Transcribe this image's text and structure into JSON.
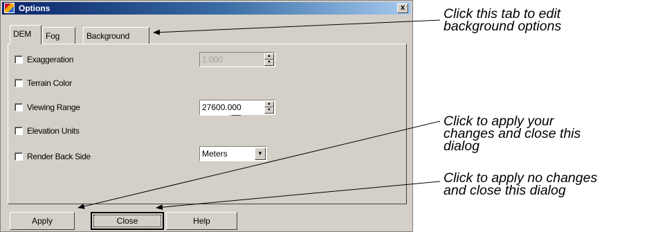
{
  "dialog": {
    "title": "Options",
    "close_label": "x",
    "tabs": [
      {
        "label": "DEM",
        "active": true
      },
      {
        "label": "Fog",
        "active": false
      },
      {
        "label": "Background",
        "active": false
      }
    ],
    "rows": [
      {
        "label": "Exaggeration",
        "checked": false
      },
      {
        "label": "Terrain Color",
        "checked": false
      },
      {
        "label": "Viewing Range",
        "checked": false
      },
      {
        "label": "Elevation Units",
        "checked": false
      },
      {
        "label": "Render Back Side",
        "checked": false
      }
    ],
    "exaggeration_value": "1.000",
    "terrain_color": "#6fa86a",
    "viewing_range_value": "27600.000",
    "elevation_units_value": "Meters",
    "buttons": {
      "apply": "Apply",
      "close": "Close",
      "help": "Help"
    }
  },
  "annotations": {
    "tab": [
      "Click this tab to edit",
      "background options"
    ],
    "apply": [
      "Click to apply your",
      "changes and close this",
      "dialog"
    ],
    "close": [
      "Click to apply no changes",
      "and close this dialog"
    ]
  },
  "icons": {
    "app": "options-app-icon",
    "close": "close-icon",
    "spin_up": "spin-up-icon",
    "spin_down": "spin-down-icon",
    "dropdown": "chevron-down-icon"
  }
}
